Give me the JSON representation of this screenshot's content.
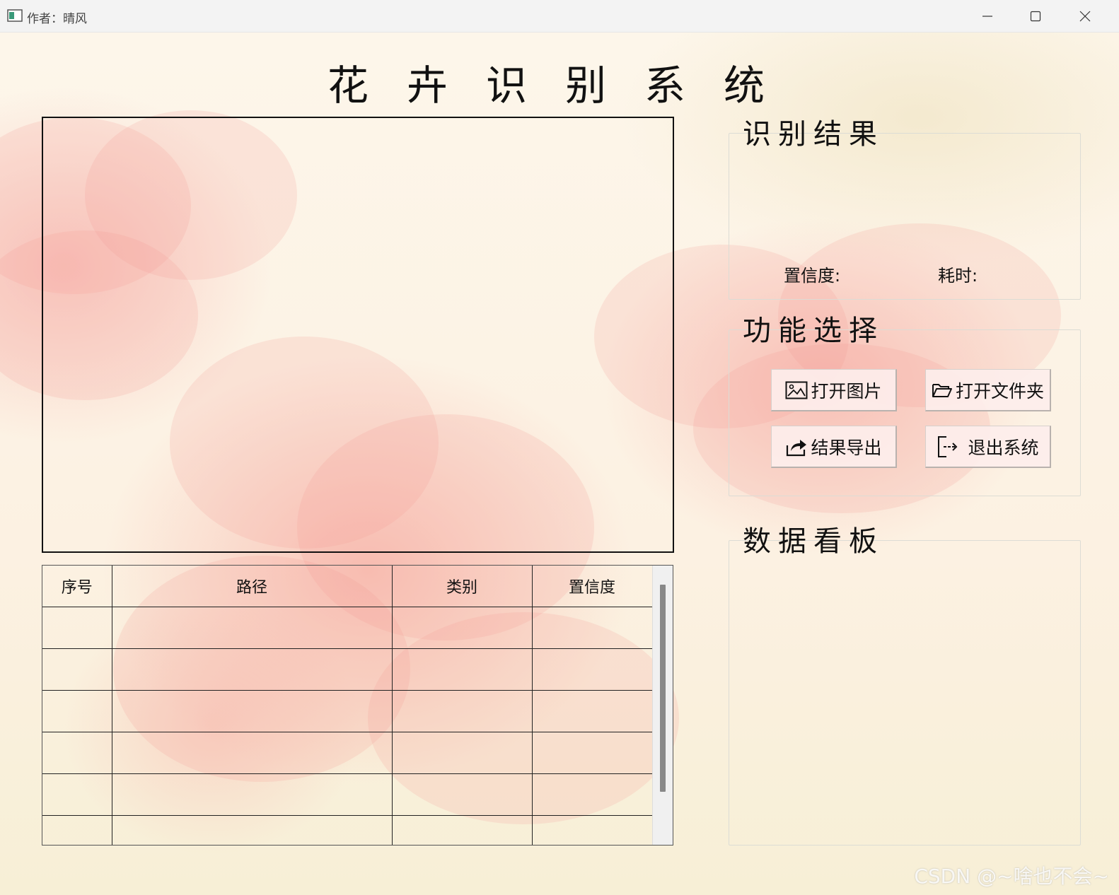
{
  "window": {
    "title": "作者：晴风"
  },
  "header": {
    "title": "花卉识别系统"
  },
  "result_panel": {
    "title": "识别结果",
    "confidence_label": "置信度:",
    "time_label": "耗时:"
  },
  "function_panel": {
    "title": "功能选择",
    "buttons": [
      {
        "label": "打开图片",
        "icon": "image-icon"
      },
      {
        "label": "打开文件夹",
        "icon": "folder-open-icon"
      },
      {
        "label": "结果导出",
        "icon": "export-icon"
      },
      {
        "label": "退出系统",
        "icon": "exit-icon"
      }
    ]
  },
  "dashboard_panel": {
    "title": "数据看板"
  },
  "table": {
    "columns": [
      "序号",
      "路径",
      "类别",
      "置信度"
    ],
    "rows": [
      [
        "",
        "",
        "",
        ""
      ],
      [
        "",
        "",
        "",
        ""
      ],
      [
        "",
        "",
        "",
        ""
      ],
      [
        "",
        "",
        "",
        ""
      ],
      [
        "",
        "",
        "",
        ""
      ],
      [
        "",
        "",
        "",
        ""
      ]
    ]
  },
  "watermark": "CSDN @~啥也不会~",
  "colors": {
    "accent_petal": "#f4a9a3",
    "background": "#fbf3e6"
  }
}
